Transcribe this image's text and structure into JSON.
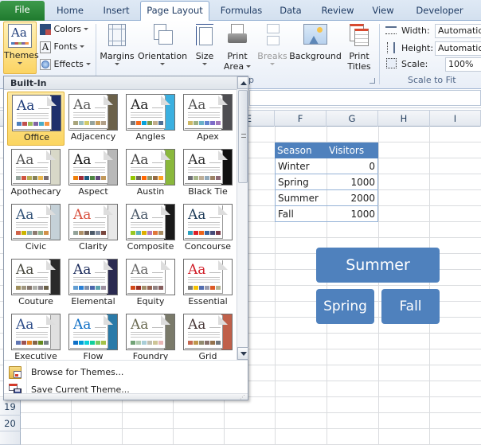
{
  "tabs": [
    {
      "label": "File",
      "type": "file"
    },
    {
      "label": "Home"
    },
    {
      "label": "Insert"
    },
    {
      "label": "Page Layout",
      "active": true
    },
    {
      "label": "Formulas"
    },
    {
      "label": "Data"
    },
    {
      "label": "Review"
    },
    {
      "label": "View"
    },
    {
      "label": "Developer"
    }
  ],
  "ribbon": {
    "themes": {
      "label": "Themes"
    },
    "colors": {
      "label": "Colors"
    },
    "fonts": {
      "label": "Fonts"
    },
    "effects": {
      "label": "Effects"
    },
    "margins": {
      "label": "Margins"
    },
    "orientation": {
      "label": "Orientation"
    },
    "size": {
      "label": "Size"
    },
    "print_area": {
      "label1": "Print",
      "label2": "Area"
    },
    "breaks": {
      "label": "Breaks"
    },
    "background": {
      "label": "Background"
    },
    "print_titles": {
      "label1": "Print",
      "label2": "Titles"
    },
    "page_setup_group_fragment": "p",
    "scale_to_fit": {
      "width_label": "Width:",
      "width_value": "Automatic",
      "height_label": "Height:",
      "height_value": "Automatic",
      "scale_label": "Scale:",
      "scale_value": "100%",
      "group_label": "Scale to Fit"
    }
  },
  "columns": [
    "E",
    "F",
    "G",
    "H",
    "I"
  ],
  "rows_visible": [
    "19",
    "20"
  ],
  "table": {
    "headers": [
      "Season",
      "Visitors"
    ],
    "rows": [
      [
        "Winter",
        "0"
      ],
      [
        "Spring",
        "1000"
      ],
      [
        "Summer",
        "2000"
      ],
      [
        "Fall",
        "1000"
      ]
    ]
  },
  "smartart": {
    "top": "Summer",
    "bottom_left": "Spring",
    "bottom_right": "Fall",
    "color": "#4f81bd"
  },
  "themes_gallery": {
    "header": "Built-In",
    "selected": "Office",
    "themes": [
      {
        "name": "Office",
        "aa": "#1f3d7a",
        "side": "#1f2f6b",
        "swatches": [
          "#4f81bd",
          "#c0504d",
          "#9bbb59",
          "#8064a2",
          "#4bacc6",
          "#f79646"
        ]
      },
      {
        "name": "Adjacency",
        "aa": "#5a5a5a",
        "side": "#6b614a",
        "swatches": [
          "#a9a57c",
          "#9cbebd",
          "#d2cb6c",
          "#95a39d",
          "#c89f5d",
          "#b1a089"
        ]
      },
      {
        "name": "Angles",
        "aa": "#222222",
        "side": "#3bb0e0",
        "swatches": [
          "#797b7e",
          "#f96a1b",
          "#08a1d9",
          "#7c984a",
          "#c2ad8d",
          "#506e94"
        ]
      },
      {
        "name": "Apex",
        "aa": "#555555",
        "side": "#4e4e52",
        "swatches": [
          "#ceb966",
          "#9cb084",
          "#6bb1c9",
          "#6585cf",
          "#7e6bc9",
          "#a379bb"
        ]
      },
      {
        "name": "Apothecary",
        "aa": "#555555",
        "side": "#d8d8c8",
        "swatches": [
          "#93a299",
          "#cf543f",
          "#b5ae53",
          "#848058",
          "#e8b54d",
          "#786c71"
        ]
      },
      {
        "name": "Aspect",
        "aa": "#111111",
        "side": "#b8b8b8",
        "swatches": [
          "#f07f09",
          "#9f2936",
          "#1b587c",
          "#4e8542",
          "#604878",
          "#c19859"
        ]
      },
      {
        "name": "Austin",
        "aa": "#444444",
        "side": "#8ab83c",
        "swatches": [
          "#94c600",
          "#71685a",
          "#ff6700",
          "#909465",
          "#956b43",
          "#fea022"
        ]
      },
      {
        "name": "Black Tie",
        "aa": "#333333",
        "side": "#111111",
        "swatches": [
          "#6f6f74",
          "#a7b789",
          "#beae98",
          "#92a9b9",
          "#9c8265",
          "#8d6974"
        ]
      },
      {
        "name": "Civic",
        "aa": "#35557a",
        "side": "#c5d1d8",
        "swatches": [
          "#d16349",
          "#ccb400",
          "#8cadae",
          "#8c7b70",
          "#8fb08c",
          "#d19049"
        ]
      },
      {
        "name": "Clarity",
        "aa": "#d8513f",
        "side": "#e8e8e8",
        "swatches": [
          "#93a299",
          "#ad8f67",
          "#726056",
          "#4c5a6a",
          "#808da0",
          "#79463d"
        ]
      },
      {
        "name": "Composite",
        "aa": "#4c5a6a",
        "side": "#1a1a1a",
        "swatches": [
          "#98c723",
          "#59b0b9",
          "#deae00",
          "#b77bb4",
          "#e0773c",
          "#a98d63"
        ]
      },
      {
        "name": "Concourse",
        "aa": "#1f3d5a",
        "side": "#ffffff",
        "swatches": [
          "#2da2bf",
          "#da1f28",
          "#eb641b",
          "#39639d",
          "#474b78",
          "#7d3c4a"
        ]
      },
      {
        "name": "Couture",
        "aa": "#4a4a40",
        "side": "#2a2a2a",
        "swatches": [
          "#9e8e5c",
          "#a09781",
          "#85776d",
          "#aeafa9",
          "#8d878b",
          "#6b6149"
        ]
      },
      {
        "name": "Elemental",
        "aa": "#1a2a5a",
        "side": "#2a2a50",
        "swatches": [
          "#629dd1",
          "#297fd5",
          "#7f8fa9",
          "#4a66ac",
          "#5aa2ae",
          "#9d90a0"
        ]
      },
      {
        "name": "Equity",
        "aa": "#6a6a6a",
        "side": "#ffffff",
        "swatches": [
          "#d34817",
          "#9b2d1f",
          "#a28e6a",
          "#956251",
          "#918485",
          "#855d5d"
        ]
      },
      {
        "name": "Essential",
        "aa": "#d0202a",
        "side": "#ffffff",
        "swatches": [
          "#7a7a7a",
          "#f5c201",
          "#526db0",
          "#989aac",
          "#dc5924",
          "#b4b392"
        ]
      },
      {
        "name": "Executive",
        "aa": "#2f4e8a",
        "side": "#e0e0e0",
        "swatches": [
          "#6076b4",
          "#9c5252",
          "#e68422",
          "#846648",
          "#63891f",
          "#758085"
        ]
      },
      {
        "name": "Flow",
        "aa": "#0f6fc6",
        "side": "#2a7aa8",
        "swatches": [
          "#0f6fc6",
          "#009dd9",
          "#0bd0d9",
          "#10cf9b",
          "#7cca62",
          "#a5c249"
        ]
      },
      {
        "name": "Foundry",
        "aa": "#6a6a50",
        "side": "#7a7a6a",
        "swatches": [
          "#72a376",
          "#b0ccb0",
          "#a8cdd7",
          "#c0beaf",
          "#cec597",
          "#e8b7b7"
        ]
      },
      {
        "name": "Grid",
        "aa": "#4a3a3a",
        "side": "#c0604a",
        "swatches": [
          "#c66951",
          "#bf974d",
          "#928b70",
          "#87706b",
          "#94734e",
          "#6f777d"
        ]
      }
    ],
    "menu": [
      {
        "label": "Browse for Themes...",
        "icon": "folder-icon"
      },
      {
        "label": "Save Current Theme...",
        "icon": "save-theme-icon"
      }
    ]
  }
}
